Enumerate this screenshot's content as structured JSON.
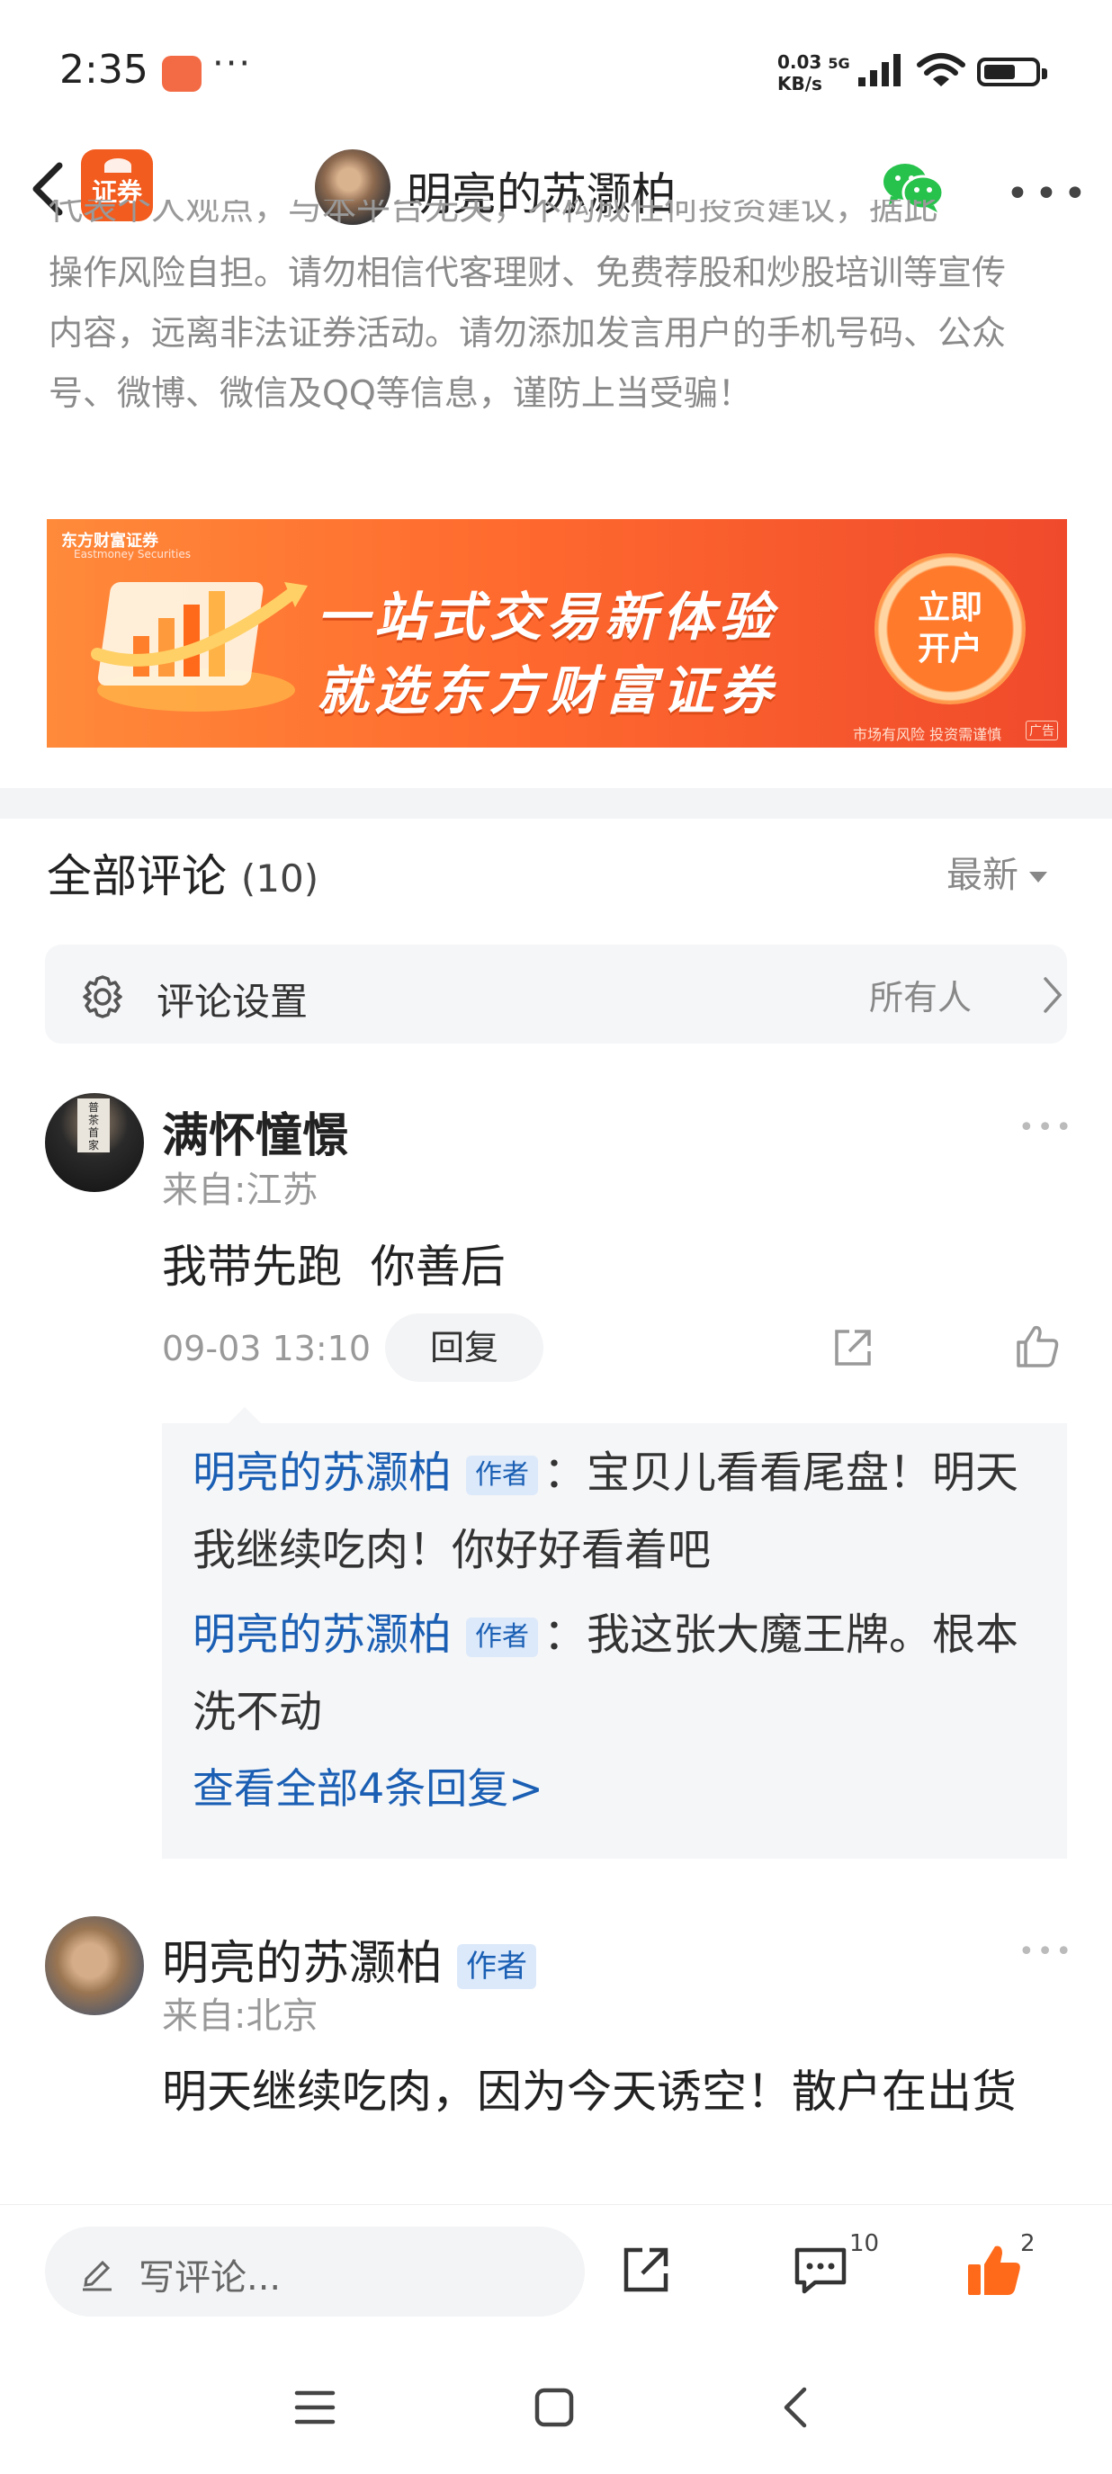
{
  "status_bar": {
    "time": "2:35",
    "dots": "···",
    "net_speed_top": "0.03",
    "net_speed_unit": "KB/s",
    "network": "5G"
  },
  "nav": {
    "logo_text": "证券",
    "title": "明亮的苏灏柏"
  },
  "disclaimer": {
    "cut_line": "代表个人观点，与本平台无关，不构成任何投资建议，据此",
    "lines": [
      "操作风险自担。请勿相信代客理财、免费荐股和炒股培训等宣传",
      "内容，远离非法证券活动。请勿添加发言用户的手机号码、公众",
      "号、微博、微信及QQ等信息，谨防上当受骗！"
    ]
  },
  "ad": {
    "brand": "东方财富证券",
    "brand_en": "Eastmoney Securities",
    "line1": "一站式交易新体验",
    "line2": "就选东方财富证券",
    "cta_line1": "立即",
    "cta_line2": "开户",
    "risk": "市场有风险 投资需谨慎",
    "ad_tag": "广告"
  },
  "comments_header": {
    "title": "全部评论",
    "count": "(10)",
    "sort": "最新"
  },
  "settings": {
    "label": "评论设置",
    "value": "所有人"
  },
  "comment1": {
    "name": "满怀憧憬",
    "location": "来自:江苏",
    "text": "我带先跑  你善后",
    "time": "09-03 13:10",
    "reply_label": "回复",
    "avatar_sign": "普茶首家",
    "replies": [
      {
        "name": "明亮的苏灏柏",
        "tag": "作者",
        "text": "：宝贝儿看看尾盘！明天我继续吃肉！你好好看着吧"
      },
      {
        "name": "明亮的苏灏柏",
        "tag": "作者",
        "text": "：我这张大魔王牌。根本洗不动"
      }
    ],
    "view_all": "查看全部4条回复>"
  },
  "comment2": {
    "name": "明亮的苏灏柏",
    "tag": "作者",
    "location": "来自:北京",
    "text": "明天继续吃肉，因为今天诱空！散户在出货"
  },
  "bottom_bar": {
    "placeholder": "写评论...",
    "comment_count": "10",
    "like_count": "2"
  },
  "colors": {
    "link_blue": "#1a5fb4",
    "brand_orange": "#f25c1e",
    "like_orange": "#ff6a1a"
  }
}
